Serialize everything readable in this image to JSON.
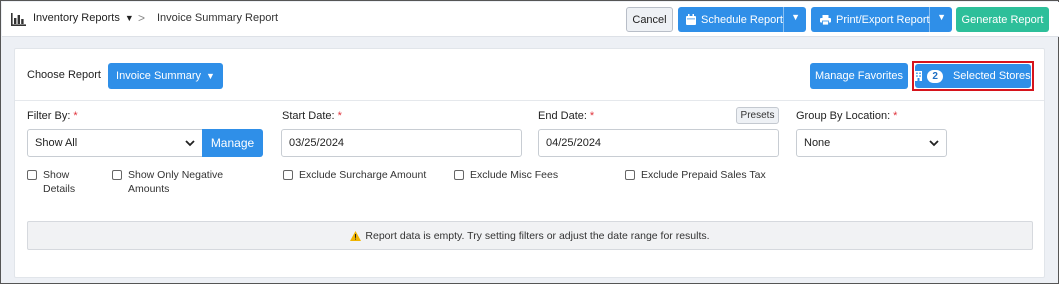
{
  "breadcrumb": {
    "section": "Inventory Reports",
    "separator": ">",
    "current": "Invoice Summary Report"
  },
  "header": {
    "cancel_label": "Cancel",
    "schedule_label": "Schedule Report",
    "print_label": "Print/Export Report",
    "generate_label": "Generate Report"
  },
  "report": {
    "choose_label": "Choose Report",
    "selected_report": "Invoice Summary",
    "manage_favorites_label": "Manage Favorites",
    "stores_count": "2",
    "stores_label": "Selected Stores"
  },
  "filters": {
    "filter_by_label": "Filter By:",
    "filter_by_value": "Show All",
    "manage_label": "Manage",
    "start_date_label": "Start Date:",
    "start_date_value": "03/25/2024",
    "end_date_label": "End Date:",
    "end_date_value": "04/25/2024",
    "presets_label": "Presets",
    "group_by_label": "Group By Location:",
    "group_by_value": "None",
    "required_mark": "*"
  },
  "options": {
    "show_details_1": "Show",
    "show_details_2": "Details",
    "show_negative_1": "Show Only Negative",
    "show_negative_2": "Amounts",
    "exclude_surcharge": "Exclude Surcharge Amount",
    "exclude_misc": "Exclude Misc Fees",
    "exclude_prepaid": "Exclude Prepaid Sales Tax"
  },
  "alert": {
    "message": "Report data is empty. Try setting filters or adjust the date range for results."
  },
  "colors": {
    "primary": "#2f8fe8",
    "success": "#2dbf9a",
    "highlight_border": "#d6141c",
    "required": "#e0333c",
    "warning": "#f0b400"
  },
  "icons": {
    "breadcrumb": "bar-chart-icon",
    "schedule": "calendar-icon",
    "print": "printer-icon",
    "stores": "store-icon",
    "alert": "warning-icon"
  }
}
